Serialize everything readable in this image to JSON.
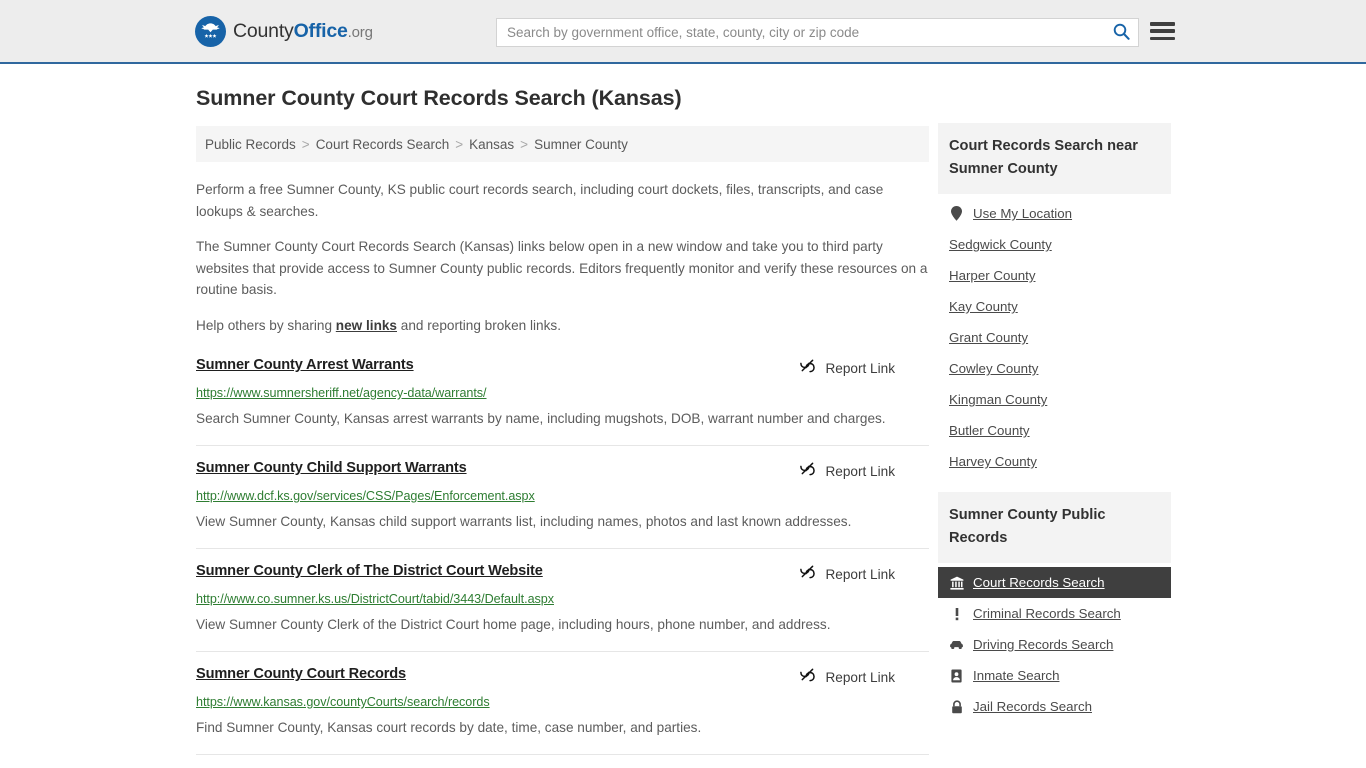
{
  "header": {
    "logo": {
      "part1": "County",
      "part2": "Office",
      "part3": ".org",
      "icon": "eagle-stars-seal-icon"
    },
    "search": {
      "placeholder": "Search by government office, state, county, city or zip code",
      "value": "",
      "button_icon": "search-icon"
    },
    "menu_icon": "hamburger-menu-icon",
    "accent_color": "#1763a8",
    "background_color": "#ededed",
    "border_color": "#30689e"
  },
  "main": {
    "title": "Sumner County Court Records Search (Kansas)",
    "breadcrumb": [
      "Public Records",
      "Court Records Search",
      "Kansas",
      "Sumner County"
    ],
    "breadcrumb_separator": ">",
    "intro": {
      "p1": "Perform a free Sumner County, KS public court records search, including court dockets, files, transcripts, and case lookups & searches.",
      "p2": "The Sumner County Court Records Search (Kansas) links below open in a new window and take you to third party websites that provide access to Sumner County public records. Editors frequently monitor and verify these resources on a routine basis.",
      "p3_before": "Help others by sharing ",
      "p3_link": "new links",
      "p3_after": " and reporting broken links."
    },
    "report_link_label": "Report Link",
    "report_link_icon": "broken-link-icon",
    "results": [
      {
        "title": "Sumner County Arrest Warrants",
        "url": "https://www.sumnersheriff.net/agency-data/warrants/",
        "description": "Search Sumner County, Kansas arrest warrants by name, including mugshots, DOB, warrant number and charges."
      },
      {
        "title": "Sumner County Child Support Warrants",
        "url": "http://www.dcf.ks.gov/services/CSS/Pages/Enforcement.aspx",
        "description": "View Sumner County, Kansas child support warrants list, including names, photos and last known addresses."
      },
      {
        "title": "Sumner County Clerk of The District Court Website",
        "url": "http://www.co.sumner.ks.us/DistrictCourt/tabid/3443/Default.aspx",
        "description": "View Sumner County Clerk of the District Court home page, including hours, phone number, and address."
      },
      {
        "title": "Sumner County Court Records",
        "url": "https://www.kansas.gov/countyCourts/search/records",
        "description": "Find Sumner County, Kansas court records by date, time, case number, and parties."
      }
    ]
  },
  "sidebar": {
    "nearby": {
      "heading": "Court Records Search near Sumner County",
      "items": [
        {
          "label": "Use My Location",
          "icon": "map-pin-icon"
        },
        {
          "label": "Sedgwick County",
          "icon": ""
        },
        {
          "label": "Harper County",
          "icon": ""
        },
        {
          "label": "Kay County",
          "icon": ""
        },
        {
          "label": "Grant County",
          "icon": ""
        },
        {
          "label": "Cowley County",
          "icon": ""
        },
        {
          "label": "Kingman County",
          "icon": ""
        },
        {
          "label": "Butler County",
          "icon": ""
        },
        {
          "label": "Harvey County",
          "icon": ""
        }
      ]
    },
    "public_records": {
      "heading": "Sumner County Public Records",
      "active_background": "#3f3f3f",
      "items": [
        {
          "label": "Court Records Search",
          "icon": "courthouse-icon",
          "active": true
        },
        {
          "label": "Criminal Records Search",
          "icon": "exclamation-icon",
          "active": false
        },
        {
          "label": "Driving Records Search",
          "icon": "car-icon",
          "active": false
        },
        {
          "label": "Inmate Search",
          "icon": "id-badge-icon",
          "active": false
        },
        {
          "label": "Jail Records Search",
          "icon": "lock-icon",
          "active": false
        }
      ]
    }
  }
}
